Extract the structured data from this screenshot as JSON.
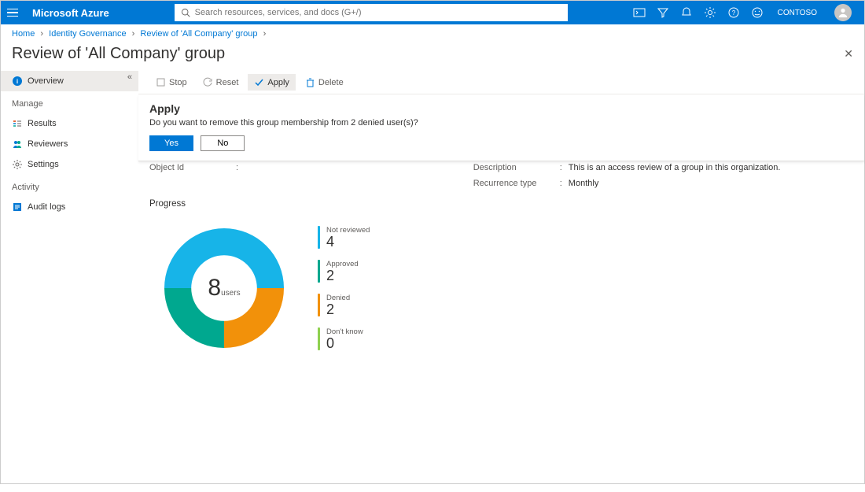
{
  "topbar": {
    "brand": "Microsoft Azure",
    "search_placeholder": "Search resources, services, and docs (G+/)",
    "org": "CONTOSO"
  },
  "breadcrumb": {
    "items": [
      "Home",
      "Identity Governance",
      "Review of 'All Company' group"
    ]
  },
  "page": {
    "title": "Review of 'All Company' group"
  },
  "sidebar": {
    "overview": "Overview",
    "manage_header": "Manage",
    "results": "Results",
    "reviewers": "Reviewers",
    "settings": "Settings",
    "activity_header": "Activity",
    "audit_logs": "Audit logs"
  },
  "toolbar": {
    "stop": "Stop",
    "reset": "Reset",
    "apply": "Apply",
    "delete": "Delete"
  },
  "confirm": {
    "title": "Apply",
    "message": "Do you want to remove this group membership from 2 denied user(s)?",
    "yes": "Yes",
    "no": "No"
  },
  "details": {
    "object_id_label": "Object Id",
    "object_id_value": "",
    "description_label": "Description",
    "description_value": "This is an access review of a group in this organization.",
    "recurrence_label": "Recurrence type",
    "recurrence_value": "Monthly"
  },
  "progress": {
    "title": "Progress",
    "total": "8",
    "total_label": "users",
    "legend": [
      {
        "label": "Not reviewed",
        "value": "4",
        "color": "#17b4e8"
      },
      {
        "label": "Approved",
        "value": "2",
        "color": "#00a88f"
      },
      {
        "label": "Denied",
        "value": "2",
        "color": "#f2910a"
      },
      {
        "label": "Don't know",
        "value": "0",
        "color": "#8fd14f"
      }
    ]
  },
  "chart_data": {
    "type": "pie",
    "title": "Progress",
    "categories": [
      "Not reviewed",
      "Approved",
      "Denied",
      "Don't know"
    ],
    "values": [
      4,
      2,
      2,
      0
    ],
    "colors": [
      "#17b4e8",
      "#00a88f",
      "#f2910a",
      "#8fd14f"
    ],
    "total_label": "8 users"
  }
}
